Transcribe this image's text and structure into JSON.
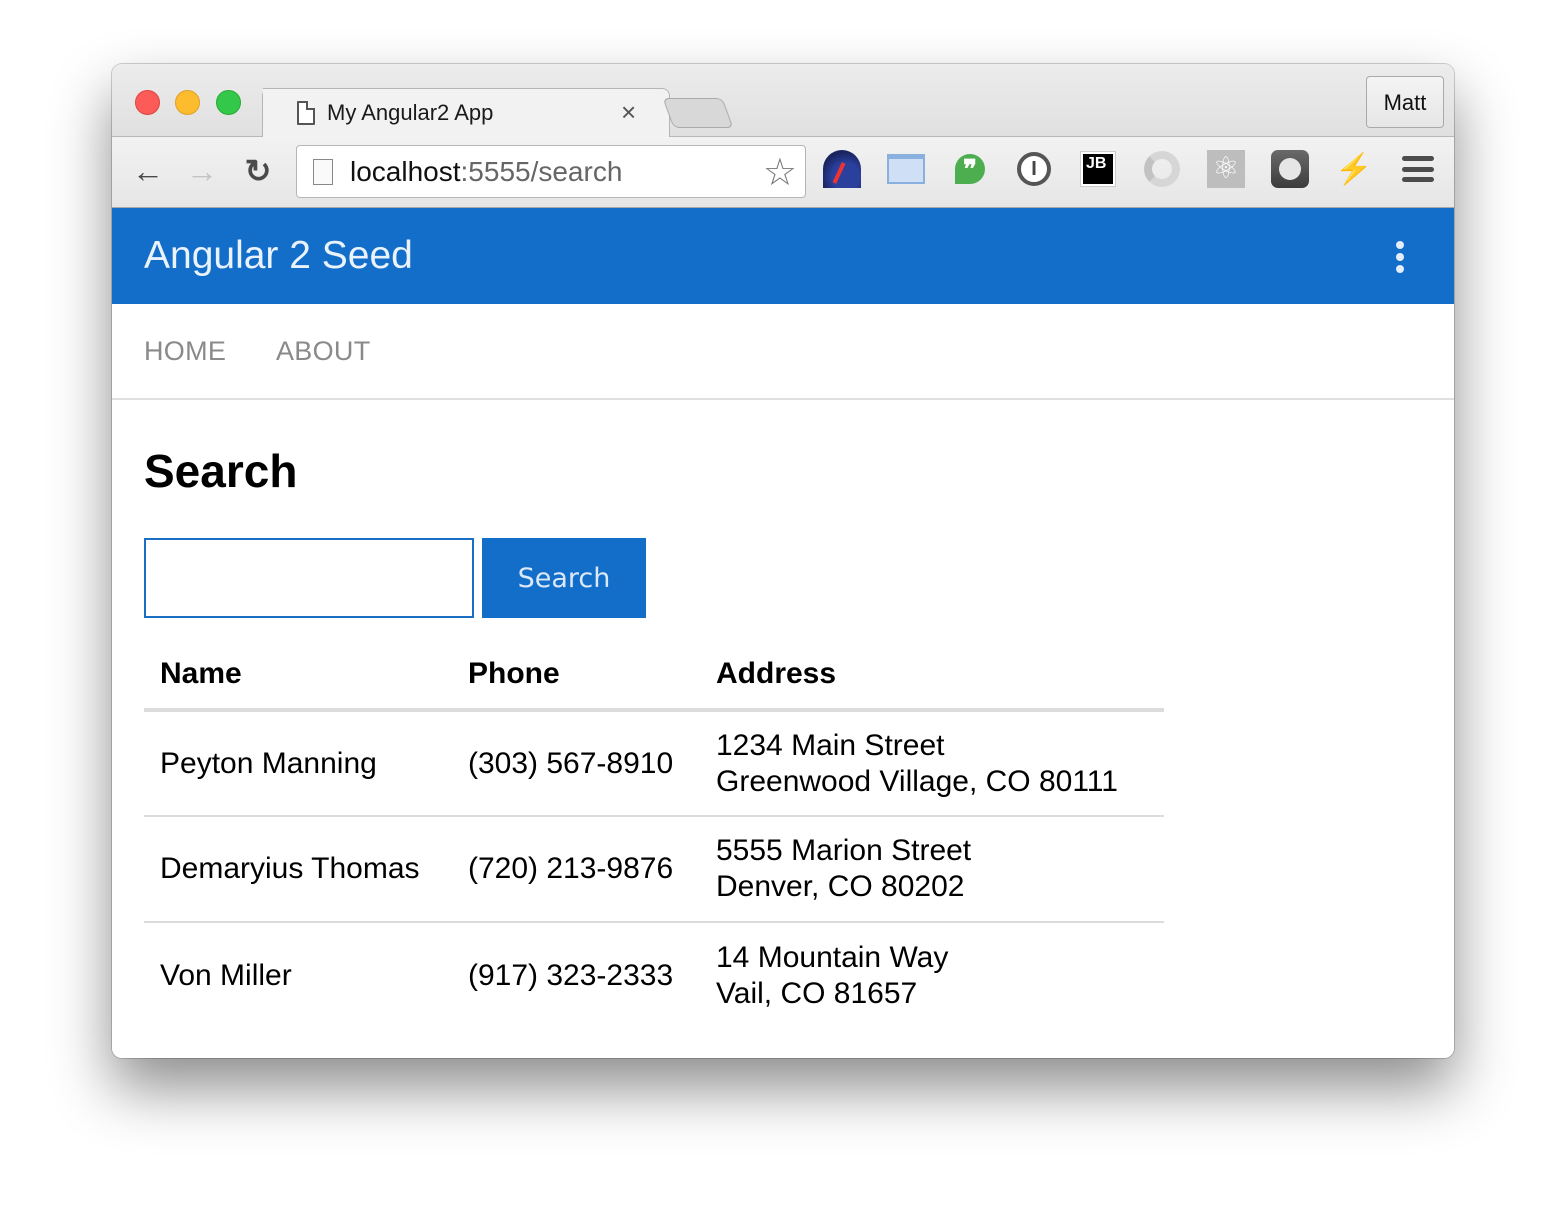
{
  "browser": {
    "tab_title": "My Angular2 App",
    "tab_close_glyph": "×",
    "profile_name": "Matt",
    "url_host": "localhost",
    "url_rest": ":5555/search",
    "star_glyph": "☆",
    "extensions": [
      "speedometer-extension-icon",
      "window-resizer-extension-icon",
      "hangouts-extension-icon",
      "1password-extension-icon",
      "jetbrains-extension-icon",
      "json-viewer-extension-icon",
      "react-devtools-extension-icon",
      "dark-reader-extension-icon",
      "lightning-extension-icon"
    ],
    "hangouts_glyph": "❞",
    "onepw_glyph": "I",
    "jb_glyph": "JB",
    "react_glyph": "⚛",
    "bolt_glyph": "⚡",
    "back_glyph": "←",
    "forward_glyph": "→",
    "reload_glyph": "↻"
  },
  "app": {
    "title": "Angular 2 Seed",
    "accent_color": "#126ec9",
    "nav": [
      {
        "label": "HOME"
      },
      {
        "label": "ABOUT"
      }
    ]
  },
  "search": {
    "heading": "Search",
    "input_value": "",
    "input_placeholder": "",
    "button_label": "Search"
  },
  "results": {
    "columns": [
      "Name",
      "Phone",
      "Address"
    ],
    "rows": [
      {
        "name": "Peyton Manning",
        "phone": "(303) 567-8910",
        "address_line1": "1234 Main Street",
        "address_line2": "Greenwood Village, CO 80111"
      },
      {
        "name": "Demaryius Thomas",
        "phone": "(720) 213-9876",
        "address_line1": "5555 Marion Street",
        "address_line2": "Denver, CO 80202"
      },
      {
        "name": "Von Miller",
        "phone": "(917) 323-2333",
        "address_line1": "14 Mountain Way",
        "address_line2": "Vail, CO 81657"
      }
    ]
  }
}
